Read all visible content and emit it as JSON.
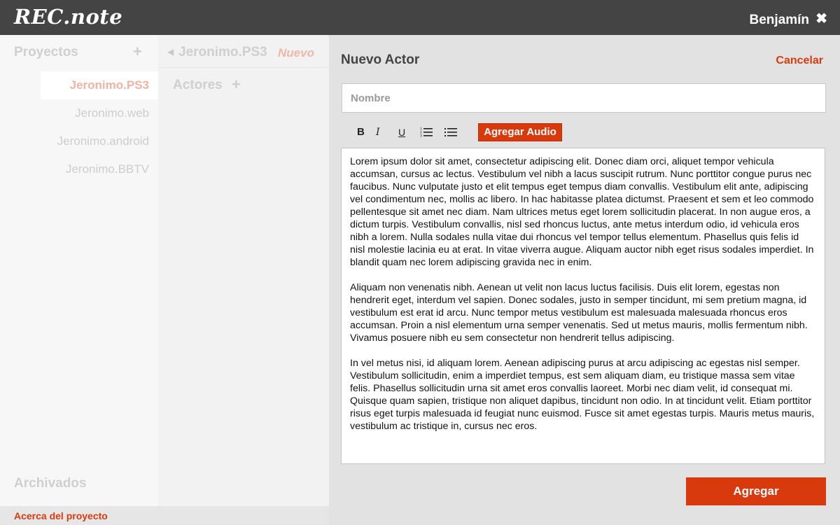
{
  "app": {
    "title": "REC.note"
  },
  "header": {
    "user_name": "Benjamín",
    "close_glyph": "✖"
  },
  "projects": {
    "title": "Proyectos",
    "add_glyph": "+",
    "items": [
      {
        "label": "Jeronimo.PS3",
        "active": true
      },
      {
        "label": "Jeronimo.web",
        "active": false
      },
      {
        "label": "Jeronimo.android",
        "active": false
      },
      {
        "label": "Jeronimo.BBTV",
        "active": false
      }
    ],
    "archived_label": "Archivados",
    "about_label": "Acerca del proyecto"
  },
  "project_detail": {
    "back_glyph": "◀",
    "title": "Jeronimo.PS3",
    "new_label": "Nuevo",
    "actors_label": "Actores",
    "add_glyph": "+"
  },
  "form": {
    "title": "Nuevo Actor",
    "cancel_label": "Cancelar",
    "name_placeholder": "Nombre",
    "toolbar": {
      "bold": "B",
      "italic": "I",
      "underline": "U",
      "audio_label": "Agregar Audio"
    },
    "paragraphs": [
      "Lorem ipsum dolor sit amet, consectetur adipiscing elit. Donec diam orci, aliquet tempor vehicula accumsan, cursus ac lectus. Vestibulum vel nibh a lacus suscipit rutrum. Nunc porttitor congue purus nec faucibus. Nunc vulputate justo et elit tempus eget tempus diam convallis. Vestibulum elit ante, adipiscing vel condimentum nec, mollis ac libero. In hac habitasse platea dictumst. Praesent et sem et leo commodo pellentesque sit amet nec diam. Nam ultrices metus eget lorem sollicitudin placerat. In non augue eros, a dictum turpis. Vestibulum convallis, nisl sed rhoncus luctus, ante metus interdum odio, id vehicula eros nibh a lorem. Nulla sodales nulla vitae dui rhoncus vel tempor tellus elementum. Phasellus quis felis id nisl molestie lacinia eu at erat. In vitae viverra augue. Aliquam auctor nibh eget risus sodales imperdiet. In blandit quam nec lorem adipiscing gravida nec in enim.",
      "Aliquam non venenatis nibh. Aenean ut velit non lacus luctus facilisis. Duis elit lorem, egestas non hendrerit eget, interdum vel sapien. Donec sodales, justo in semper tincidunt, mi sem pretium magna, id vestibulum est erat id arcu. Nunc tempor metus vestibulum est malesuada malesuada rhoncus eros accumsan. Proin a nisl elementum urna semper venenatis. Sed ut metus mauris, mollis fermentum nibh. Vivamus posuere nibh eu sem consectetur non hendrerit tellus adipiscing.",
      "In vel metus nisi, id aliquam lorem. Aenean adipiscing purus at arcu adipiscing ac egestas nisl semper. Vestibulum sollicitudin, enim a imperdiet tempus, est sem aliquam diam, eu tristique massa sem vitae felis. Phasellus sollicitudin urna sit amet eros convallis laoreet. Morbi nec diam velit, id consequat mi. Quisque quam sapien, tristique non aliquet dapibus, tincidunt non odio. In at tincidunt velit. Etiam porttitor risus eget turpis malesuada id feugiat nunc euismod. Fusce sit amet egestas turpis. Mauris metus mauris, vestibulum ac tristique in, cursus nec eros."
    ],
    "submit_label": "Agregar"
  },
  "colors": {
    "accent": "#d83a0e",
    "topbar": "#444444",
    "panel_bg": "#e2e2e2"
  },
  "icons": {
    "close": "close-icon",
    "back": "triangle-left-icon",
    "ordered_list": "ordered-list-icon",
    "bullet_list": "bullet-list-icon"
  }
}
